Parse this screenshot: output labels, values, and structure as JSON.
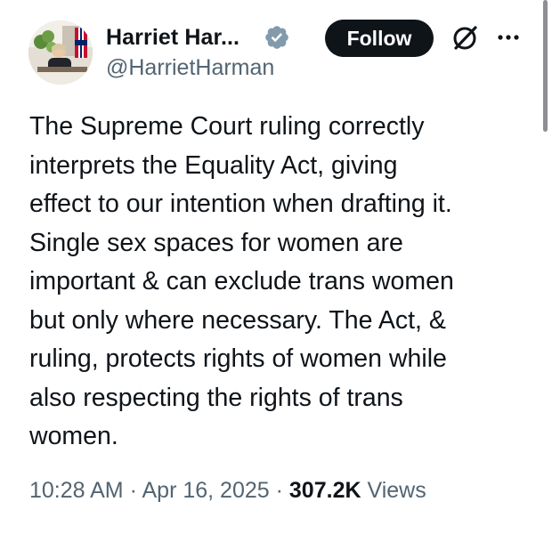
{
  "author": {
    "display_name": "Harriet Har...",
    "handle": "@HarrietHarman",
    "verified_badge_icon": "verified-badge-icon",
    "avatar_icon": "profile-photo"
  },
  "actions": {
    "follow_label": "Follow",
    "grok_icon": "grok-icon",
    "more_icon": "more-options-icon"
  },
  "tweet": {
    "text": "The Supreme Court ruling correctly\ninterprets the Equality Act, giving\neffect to our intention when drafting it.\nSingle sex spaces for women are\nimportant & can exclude trans women\nbut only where necessary.  The Act, &\nruling, protects rights of women while\nalso respecting the rights of trans\nwomen."
  },
  "meta": {
    "time": "10:28 AM",
    "separator": "·",
    "date": "Apr 16, 2025",
    "views_count": "307.2K",
    "views_label": "Views"
  },
  "colors": {
    "text_primary": "#0f1419",
    "text_secondary": "#536471",
    "verified_badge": "#829aab",
    "follow_button_bg": "#0f1419"
  }
}
